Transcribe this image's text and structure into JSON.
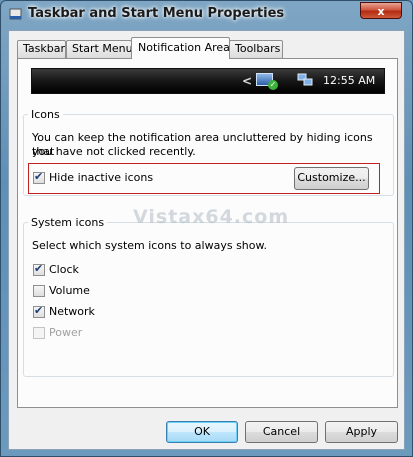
{
  "window": {
    "title": "Taskbar and Start Menu Properties",
    "close_label": "x"
  },
  "tabs": [
    {
      "label": "Taskbar"
    },
    {
      "label": "Start Menu"
    },
    {
      "label": "Notification Area",
      "active": true
    },
    {
      "label": "Toolbars"
    }
  ],
  "taskbar_preview": {
    "arrow": "<",
    "time": "12:55 AM"
  },
  "icons_group": {
    "legend": "Icons",
    "description_line1": "You can keep the notification area uncluttered by hiding icons that",
    "description_line2": "you have not clicked recently.",
    "hide_inactive": {
      "label": "Hide inactive icons",
      "checked": true
    },
    "customize_label": "Customize..."
  },
  "system_icons_group": {
    "legend": "System icons",
    "description": "Select which system icons to always show.",
    "items": [
      {
        "label": "Clock",
        "checked": true,
        "enabled": true
      },
      {
        "label": "Volume",
        "checked": false,
        "enabled": true
      },
      {
        "label": "Network",
        "checked": true,
        "enabled": true
      },
      {
        "label": "Power",
        "checked": false,
        "enabled": false
      }
    ]
  },
  "watermark": "Vistax64.com",
  "buttons": {
    "ok": "OK",
    "cancel": "Cancel",
    "apply": "Apply"
  }
}
